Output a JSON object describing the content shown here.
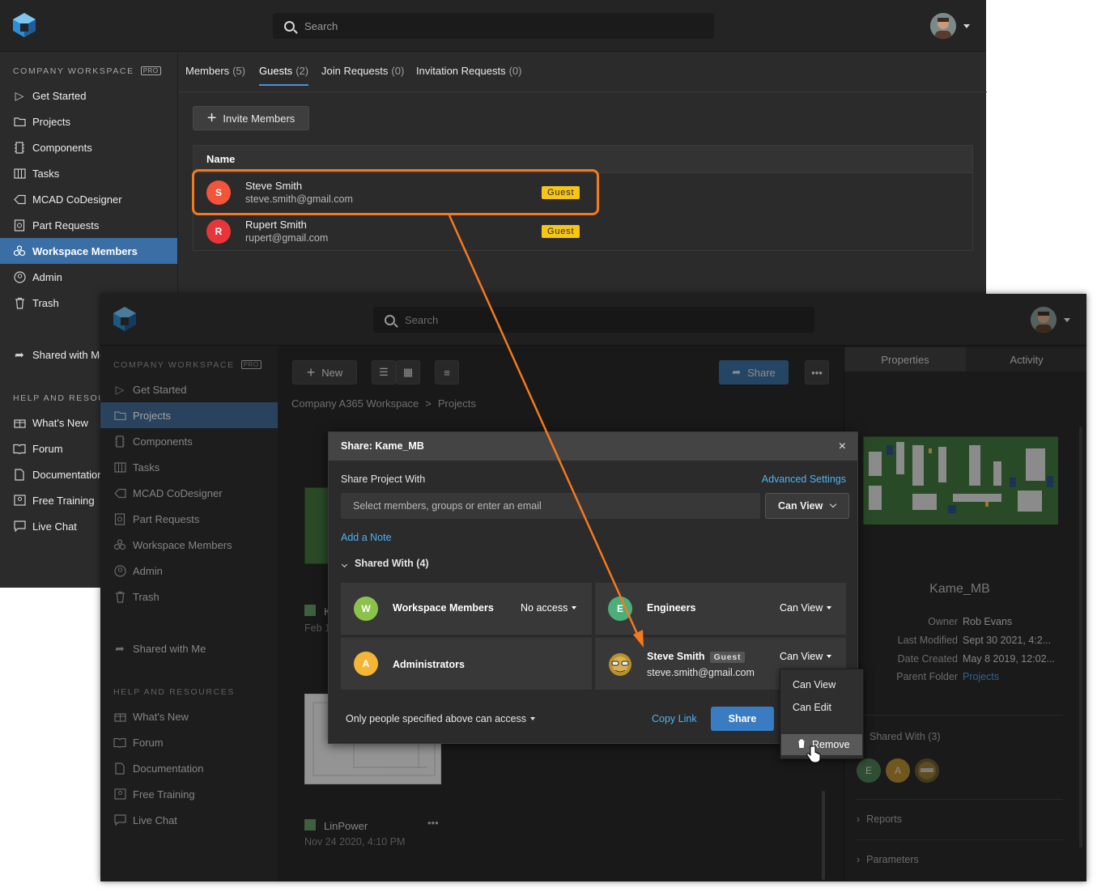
{
  "colors": {
    "accent": "#3a6ea5",
    "link": "#4fb3f0",
    "guest_badge": "#f5c518",
    "arrow": "#f47a20",
    "highlight": "#f47a20"
  },
  "back_window": {
    "search_placeholder": "Search",
    "sidebar": {
      "workspace_label": "COMPANY WORKSPACE",
      "pro_badge": "PRO",
      "items": [
        {
          "label": "Get Started",
          "icon": "play-icon"
        },
        {
          "label": "Projects",
          "icon": "folder-icon"
        },
        {
          "label": "Components",
          "icon": "component-icon"
        },
        {
          "label": "Tasks",
          "icon": "tasks-icon"
        },
        {
          "label": "MCAD CoDesigner",
          "icon": "mcad-icon"
        },
        {
          "label": "Part Requests",
          "icon": "part-request-icon"
        },
        {
          "label": "Workspace Members",
          "icon": "members-icon",
          "active": true
        },
        {
          "label": "Admin",
          "icon": "admin-icon"
        },
        {
          "label": "Trash",
          "icon": "trash-icon"
        }
      ],
      "shared_with_me": "Shared with Me",
      "help_label": "HELP AND RESOURCES",
      "help_items": [
        {
          "label": "What's New",
          "icon": "gift-icon"
        },
        {
          "label": "Forum",
          "icon": "book-icon"
        },
        {
          "label": "Documentation",
          "icon": "document-icon"
        },
        {
          "label": "Free Training",
          "icon": "training-icon"
        },
        {
          "label": "Live Chat",
          "icon": "chat-icon"
        }
      ]
    },
    "tabs": [
      {
        "label": "Members",
        "count": "(5)"
      },
      {
        "label": "Guests",
        "count": "(2)",
        "active": true
      },
      {
        "label": "Join Requests",
        "count": "(0)"
      },
      {
        "label": "Invitation Requests",
        "count": "(0)"
      }
    ],
    "invite_button": "Invite Members",
    "table": {
      "header": "Name",
      "rows": [
        {
          "initial": "S",
          "name": "Steve Smith",
          "email": "steve.smith@gmail.com",
          "badge": "Guest",
          "color": "#f2553a"
        },
        {
          "initial": "R",
          "name": "Rupert Smith",
          "email": "rupert@gmail.com",
          "badge": "Guest",
          "color": "#e8353a"
        }
      ]
    }
  },
  "front_window": {
    "search_placeholder": "Search",
    "toolbar": {
      "new_label": "New",
      "share_label": "Share"
    },
    "breadcrumb": {
      "root": "Company A365 Workspace",
      "current": "Projects"
    },
    "sidebar": {
      "workspace_label": "COMPANY WORKSPACE",
      "pro_badge": "PRO",
      "items": [
        {
          "label": "Get Started"
        },
        {
          "label": "Projects",
          "active": true
        },
        {
          "label": "Components"
        },
        {
          "label": "Tasks"
        },
        {
          "label": "MCAD CoDesigner"
        },
        {
          "label": "Part Requests"
        },
        {
          "label": "Workspace Members"
        },
        {
          "label": "Admin"
        },
        {
          "label": "Trash"
        }
      ],
      "shared_with_me": "Shared with Me",
      "help_label": "HELP AND RESOURCES",
      "help_items": [
        {
          "label": "What's New"
        },
        {
          "label": "Forum"
        },
        {
          "label": "Documentation"
        },
        {
          "label": "Free Training"
        },
        {
          "label": "Live Chat"
        }
      ]
    },
    "project_cards": [
      {
        "name": "LinPower",
        "date": "Nov 24 2020, 4:10 PM"
      },
      {
        "partial_name": "K",
        "partial_date": "Feb 1"
      }
    ],
    "right_panel": {
      "tabs": [
        "Properties",
        "Activity"
      ],
      "project_name": "Kame_MB",
      "properties": [
        {
          "key": "Owner",
          "value": "Rob Evans"
        },
        {
          "key": "Last Modified",
          "value": "Sept 30 2021, 4:2..."
        },
        {
          "key": "Date Created",
          "value": "May 8 2019, 12:02..."
        },
        {
          "key": "Parent Folder",
          "value": "Projects",
          "is_link": true
        }
      ],
      "shared_with": "Shared With (3)",
      "shared_avatars": [
        {
          "initial": "E",
          "color": "#4f8a5a"
        },
        {
          "initial": "A",
          "color": "#c99a2e"
        },
        {
          "initial": "",
          "color": "#8a7a3a"
        }
      ],
      "sections": [
        "Reports",
        "Parameters"
      ]
    }
  },
  "share_dialog": {
    "title": "Share: Kame_MB",
    "close_icon": "×",
    "share_with_label": "Share Project With",
    "advanced_settings": "Advanced Settings",
    "input_placeholder": "Select members, groups or enter an email",
    "permission_select": "Can View",
    "add_note": "Add a Note",
    "shared_with_toggle": "Shared With (4)",
    "entries": [
      {
        "initial": "W",
        "name": "Workspace Members",
        "permission": "No access",
        "color": "#8bc34a"
      },
      {
        "initial": "E",
        "name": "Engineers",
        "permission": "Can View",
        "color": "#4caf7a"
      },
      {
        "initial": "A",
        "name": "Administrators",
        "permission": "",
        "color": "#f5b638"
      },
      {
        "initial": "",
        "name": "Steve Smith",
        "badge": "Guest",
        "email": "steve.smith@gmail.com",
        "permission": "Can View",
        "color": "#c9a23a"
      }
    ],
    "access_scope": "Only people specified above can access",
    "copy_link": "Copy Link",
    "share_button": "Share"
  },
  "permission_menu": {
    "items": [
      "Can View",
      "Can Edit"
    ],
    "remove": "Remove"
  }
}
